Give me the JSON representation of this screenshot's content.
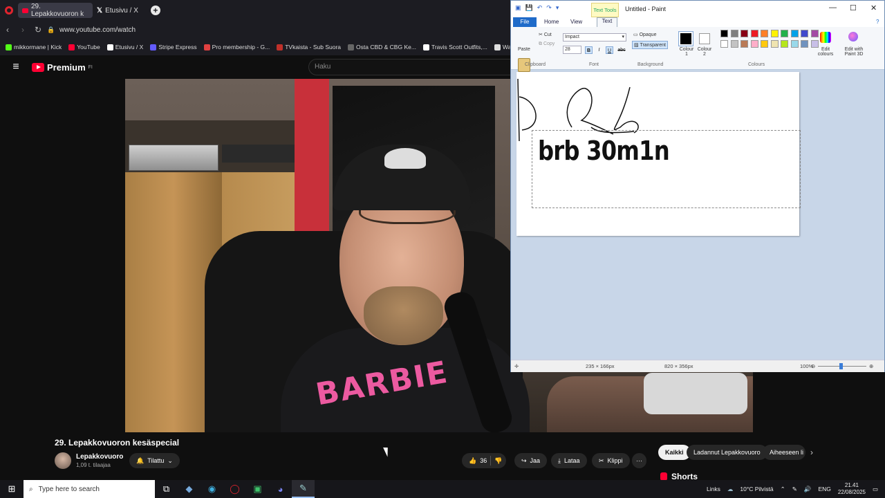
{
  "browser": {
    "tabs": [
      {
        "label": "29. Lepakkovuoron k",
        "active": true
      },
      {
        "label": "Etusivu / X",
        "active": false
      }
    ],
    "url": "www.youtube.com/watch",
    "bookmarks": [
      {
        "label": "mikkormane | Kick",
        "color": "#53fc18"
      },
      {
        "label": "YouTube",
        "color": "#ff0033"
      },
      {
        "label": "Etusivu / X",
        "color": "#ffffff"
      },
      {
        "label": "Stripe Express",
        "color": "#635bff"
      },
      {
        "label": "Pro membership - G...",
        "color": "#e04040"
      },
      {
        "label": "TVkaista - Sub Suora",
        "color": "#c0302a"
      },
      {
        "label": "Osta CBD & CBG Ke...",
        "color": "#666666"
      },
      {
        "label": "Travis Scott Outfits,...",
        "color": "#ffffff"
      },
      {
        "label": "Watch Marvel",
        "color": "#dddddd"
      }
    ]
  },
  "youtube": {
    "logo_text": "Premium",
    "region": "FI",
    "search_placeholder": "Haku",
    "video_title": "29. Lepakkovuoron kesäspecial",
    "shirt_text": "BARBIE",
    "channel_name": "Lepakkovuoro",
    "channel_subs": "1,09 t. tilaajaa",
    "subscribed_label": "Tilattu",
    "likes": "36",
    "share_label": "Jaa",
    "download_label": "Lataa",
    "clip_label": "Klippi",
    "more_label": "···",
    "chips": [
      "Kaikki",
      "Ladannut Lepakkovuoro",
      "Aiheeseen li"
    ],
    "shorts_label": "Shorts"
  },
  "paint": {
    "title": "Untitled - Paint",
    "text_tools_label": "Text Tools",
    "tabs": {
      "file": "File",
      "home": "Home",
      "view": "View",
      "text": "Text"
    },
    "clipboard": {
      "paste": "Paste",
      "cut": "Cut",
      "copy": "Copy",
      "group": "Clipboard"
    },
    "font": {
      "family": "Impact",
      "size": "28",
      "group": "Font",
      "bold": "B",
      "italic": "I",
      "underline": "U",
      "strike": "abc"
    },
    "background": {
      "opaque": "Opaque",
      "transparent": "Transparent",
      "group": "Background"
    },
    "colours": {
      "colour1": "Colour 1",
      "colour2": "Colour 2",
      "group": "Colours",
      "edit": "Edit colours",
      "edit3d": "Edit with Paint 3D",
      "palette_row1": [
        "#000000",
        "#7f7f7f",
        "#880015",
        "#ed1c24",
        "#ff7f27",
        "#fff200",
        "#22b14c",
        "#00a2e8",
        "#3f48cc",
        "#a349a4"
      ],
      "palette_row2": [
        "#ffffff",
        "#c3c3c3",
        "#b97a57",
        "#ffaec9",
        "#ffc90e",
        "#efe4b0",
        "#b5e61d",
        "#99d9ea",
        "#7092be",
        "#c8bfe7"
      ]
    },
    "canvas_text": "brb 30m1n",
    "status": {
      "selection": "235 × 166px",
      "canvas_size": "820 × 356px",
      "zoom": "100%"
    }
  },
  "taskbar": {
    "search_placeholder": "Type here to search",
    "links_label": "Links",
    "weather": "10°C  Pilvistä",
    "language": "ENG",
    "time": "21.41",
    "date": "22/08/2025"
  }
}
